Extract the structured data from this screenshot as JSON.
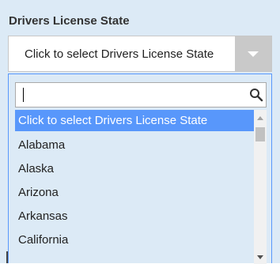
{
  "field": {
    "label": "Drivers License State",
    "selected_value": "Click to select Drivers License State"
  },
  "search": {
    "value": "",
    "placeholder": ""
  },
  "options": [
    "Click to select Drivers License State",
    "Alabama",
    "Alaska",
    "Arizona",
    "Arkansas",
    "California"
  ],
  "highlighted_index": 0,
  "colors": {
    "panel_background": "#dceaf6",
    "highlight": "#5897fb",
    "arrow_background": "#c9c9c9"
  },
  "icons": {
    "search": "search-icon",
    "dropdown": "chevron-down-icon"
  }
}
